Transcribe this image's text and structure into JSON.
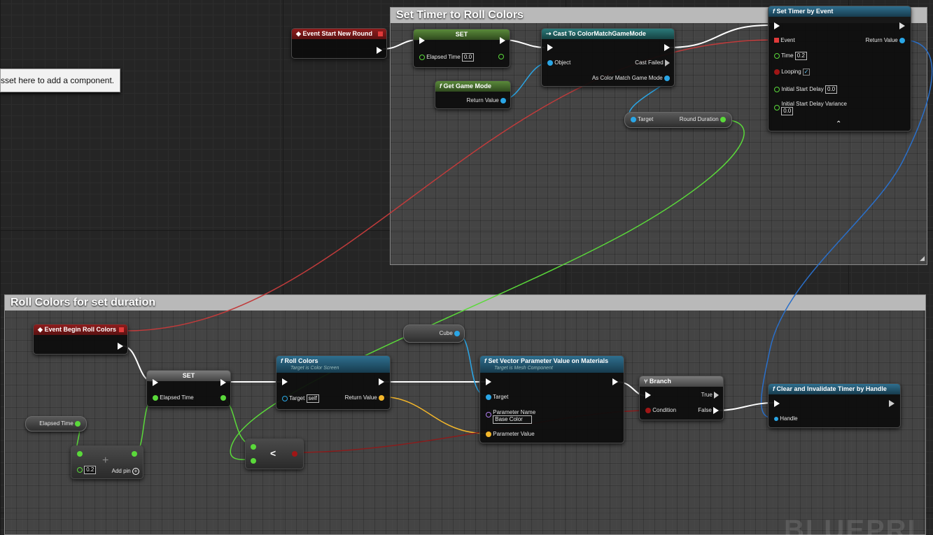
{
  "tooltip": "sset here to add a component.",
  "watermark": "BLUEPRI",
  "comments": {
    "top": "Set Timer to Roll Colors",
    "bottom": "Roll Colors for set duration"
  },
  "nodes": {
    "event_start_new_round": {
      "title": "Event Start New Round"
    },
    "set_top": {
      "title": "SET",
      "pin": "Elapsed Time",
      "value": "0.0"
    },
    "cast": {
      "title": "Cast To ColorMatchGameMode",
      "object": "Object",
      "cast_failed": "Cast Failed",
      "as_gm": "As Color Match Game Mode"
    },
    "get_game_mode": {
      "title": "Get Game Mode",
      "return_value": "Return Value"
    },
    "round_duration": {
      "target": "Target",
      "out": "Round Duration"
    },
    "set_timer": {
      "title": "Set Timer by Event",
      "event": "Event",
      "return_value": "Return Value",
      "time": "Time",
      "time_value": "0.2",
      "looping": "Looping",
      "looping_check": "✓",
      "initial_delay": "Initial Start Delay",
      "initial_delay_value": "0.0",
      "variance": "Initial Start Delay Variance",
      "variance_value": "0.0",
      "collapse": "⌃"
    },
    "event_begin_roll": {
      "title": "Event Begin Roll Colors"
    },
    "set_bottom": {
      "title": "SET",
      "pin": "Elapsed Time"
    },
    "elapsed_getter": {
      "label": "Elapsed Time"
    },
    "add": {
      "value": "0.2",
      "add_pin": "Add pin",
      "plus": "+"
    },
    "less": {
      "symbol": "<"
    },
    "roll_colors": {
      "title": "Roll Colors",
      "subtitle": "Target is Color Screen",
      "target": "Target",
      "target_value": "self",
      "return_value": "Return Value"
    },
    "cube": {
      "label": "Cube"
    },
    "set_vector": {
      "title": "Set Vector Parameter Value on Materials",
      "subtitle": "Target is Mesh Component",
      "target": "Target",
      "param_name": "Parameter Name",
      "param_name_value": "Base Color",
      "param_value": "Parameter Value"
    },
    "branch": {
      "title": "Branch",
      "condition": "Condition",
      "true_label": "True",
      "false_label": "False"
    },
    "clear_timer": {
      "title": "Clear and Invalidate Timer by Handle",
      "handle": "Handle"
    }
  },
  "colors": {
    "exec": "#ffffff",
    "float": "#5ad93a",
    "object": "#2aa6e6",
    "boolean": "#a01616",
    "struct": "#f3b62a",
    "event": "#e03a3a"
  }
}
